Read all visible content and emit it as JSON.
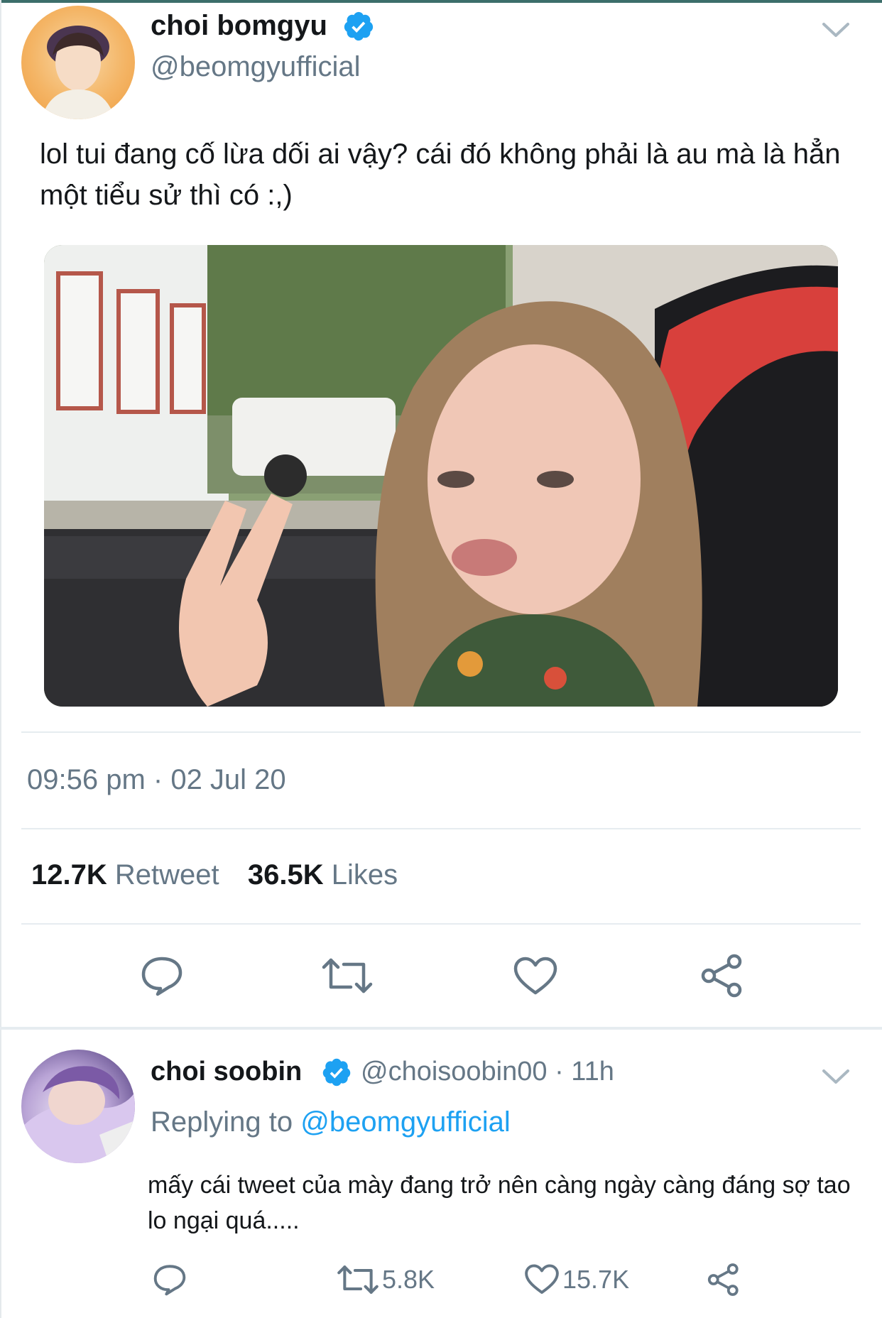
{
  "tweet": {
    "author_name": "choi bomgyu",
    "author_handle": "@beomgyufficial",
    "text": "lol tui đang cố lừa dối ai vậy? cái đó không phải là au mà là hẳn một tiểu sử thì có :,)",
    "timestamp": "09:56 pm · 02 Jul 20",
    "retweet_count": "12.7K",
    "retweet_label": "Retweet",
    "likes_count": "36.5K",
    "likes_label": "Likes",
    "icons": [
      "verified-badge-icon",
      "chevron-down-icon",
      "reply-icon",
      "retweet-icon",
      "like-icon",
      "share-icon"
    ]
  },
  "reply": {
    "author_name": "choi soobin",
    "author_handle_time": "@choisoobin00 · 11h",
    "replying_prefix": "Replying to",
    "replying_mention": "@beomgyufficial",
    "text": "mấy cái tweet của mày đang trở nên càng ngày càng đáng sợ tao lo ngại quá.....",
    "retweet_count": "5.8K",
    "like_count": "15.7K"
  },
  "colors": {
    "accent": "#1da1f2",
    "secondary_text": "#657786",
    "primary_text": "#14171a",
    "divider": "#e6ecf0"
  }
}
